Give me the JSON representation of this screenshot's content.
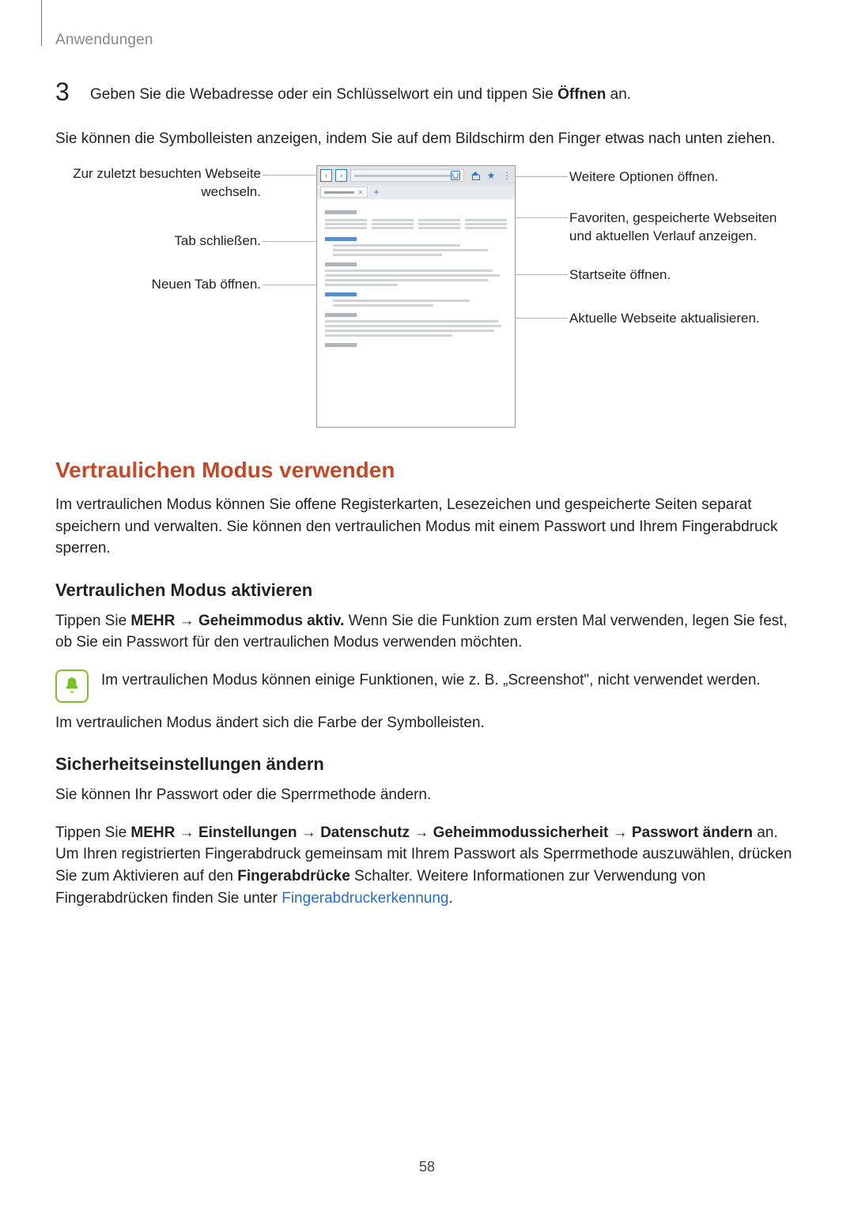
{
  "header": "Anwendungen",
  "step": {
    "number": "3",
    "text_before": "Geben Sie die Webadresse oder ein Schlüsselwort ein und tippen Sie ",
    "bold1": "Öffnen",
    "text_after": " an."
  },
  "intro_para": "Sie können die Symbolleisten anzeigen, indem Sie auf dem Bildschirm den Finger etwas nach unten ziehen.",
  "diagram": {
    "left": {
      "back_forward": "Zur zuletzt besuchten Webseite wechseln.",
      "close_tab": "Tab schließen.",
      "new_tab": "Neuen Tab öffnen."
    },
    "right": {
      "more_options": "Weitere Optionen öffnen.",
      "favorites": "Favoriten, gespeicherte Webseiten und aktuellen Verlauf anzeigen.",
      "home": "Startseite öffnen.",
      "refresh": "Aktuelle Webseite aktualisieren."
    }
  },
  "section_title": "Vertraulichen Modus verwenden",
  "section_intro": "Im vertraulichen Modus können Sie offene Registerkarten, Lesezeichen und gespeicherte Seiten separat speichern und verwalten. Sie können den vertraulichen Modus mit einem Passwort und Ihrem Fingerabdruck sperren.",
  "subsection1": {
    "title": "Vertraulichen Modus aktivieren",
    "p1_before": "Tippen Sie ",
    "p1_b1": "MEHR",
    "p1_arrow1": " → ",
    "p1_b2": "Geheimmodus aktiv.",
    "p1_after": " Wenn Sie die Funktion zum ersten Mal verwenden, legen Sie fest, ob Sie ein Passwort für den vertraulichen Modus verwenden möchten.",
    "note": "Im vertraulichen Modus können einige Funktionen, wie z. B. „Screenshot\", nicht verwendet werden.",
    "p2": "Im vertraulichen Modus ändert sich die Farbe der Symbolleisten."
  },
  "subsection2": {
    "title": "Sicherheitseinstellungen ändern",
    "p1": "Sie können Ihr Passwort oder die Sperrmethode ändern.",
    "p2_before": "Tippen Sie ",
    "p2_b1": "MEHR",
    "p2_a1": " → ",
    "p2_b2": "Einstellungen",
    "p2_a2": " → ",
    "p2_b3": "Datenschutz",
    "p2_a3": " → ",
    "p2_b4": "Geheimmodussicherheit",
    "p2_a4": " → ",
    "p2_b5": "Passwort ändern",
    "p2_mid1": " an. Um Ihren registrierten Fingerabdruck gemeinsam mit Ihrem Passwort als Sperrmethode auszuwählen, drücken Sie zum Aktivieren auf den ",
    "p2_b6": "Fingerabdrücke",
    "p2_mid2": " Schalter. Weitere Informationen zur Verwendung von Fingerabdrücken finden Sie unter ",
    "p2_link": "Fingerabdruckerkennung",
    "p2_end": "."
  },
  "page_number": "58"
}
